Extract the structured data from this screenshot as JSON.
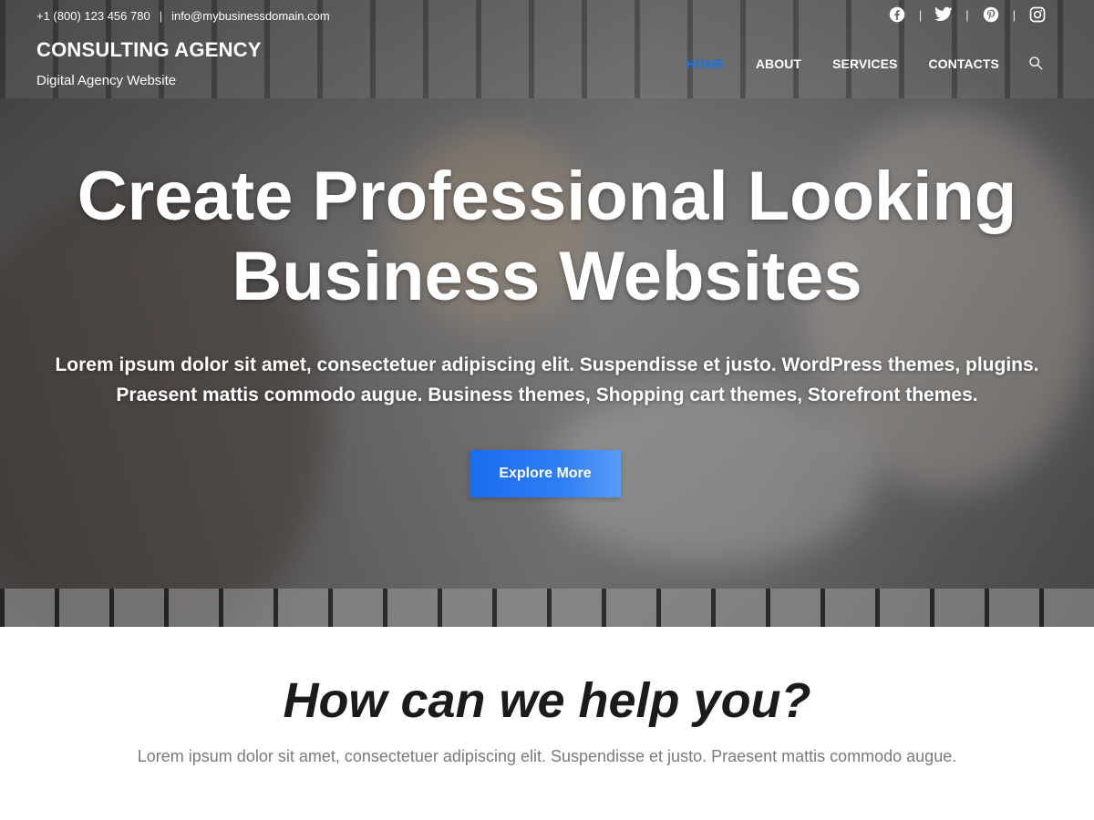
{
  "topbar": {
    "phone": "+1 (800) 123 456 780",
    "separator": "|",
    "email": "info@mybusinessdomain.com"
  },
  "social": {
    "divider": "|",
    "icons": [
      "facebook-icon",
      "twitter-icon",
      "pinterest-icon",
      "instagram-icon"
    ]
  },
  "brand": {
    "title": "CONSULTING AGENCY",
    "tagline": "Digital Agency Website"
  },
  "nav": {
    "items": [
      {
        "label": "HOME",
        "active": true
      },
      {
        "label": "ABOUT",
        "active": false
      },
      {
        "label": "SERVICES",
        "active": false
      },
      {
        "label": "CONTACTS",
        "active": false
      }
    ],
    "search_icon": "search-icon"
  },
  "hero": {
    "title_line1": "Create Professional Looking",
    "title_line2": "Business Websites",
    "subtitle_line1": "Lorem ipsum dolor sit amet, consectetuer adipiscing elit. Suspendisse et justo. WordPress themes, plugins.",
    "subtitle_line2": "Praesent mattis commodo augue. Business themes, Shopping cart themes, Storefront themes.",
    "cta_label": "Explore More"
  },
  "help": {
    "title": "How can we help you?",
    "text": "Lorem ipsum dolor sit amet, consectetuer adipiscing elit. Suspendisse et justo. Praesent mattis commodo augue."
  },
  "colors": {
    "accent": "#1a73e8",
    "cta": "#2f7ef5",
    "heading": "#1b1b1b",
    "muted_text": "#7a7a7a"
  }
}
